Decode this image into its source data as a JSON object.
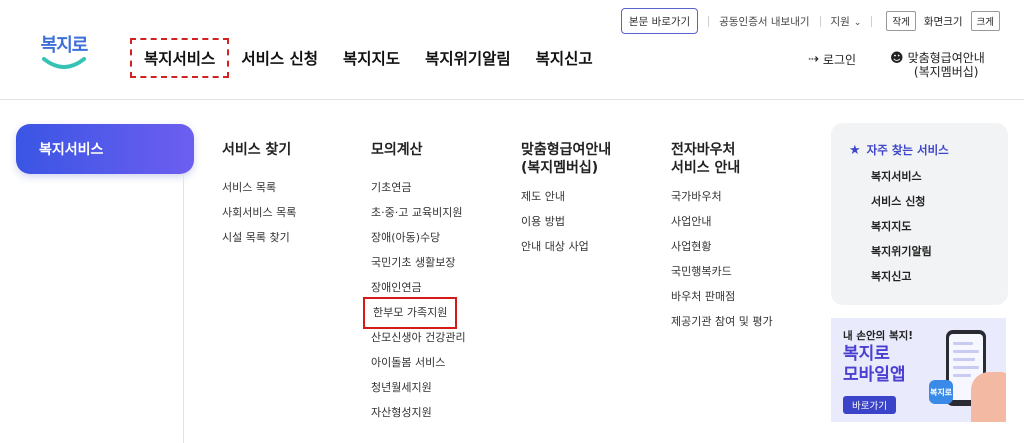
{
  "util": {
    "skip_label": "본문 바로가기",
    "cert_label": "공동인증서 내보내기",
    "support_label": "지원",
    "small_label": "작게",
    "zoom_label": "화면크기",
    "large_label": "크게"
  },
  "logo": {
    "text": "복지로"
  },
  "gnb": {
    "items": [
      {
        "label": "복지서비스"
      },
      {
        "label": "서비스 신청"
      },
      {
        "label": "복지지도"
      },
      {
        "label": "복지위기알림"
      },
      {
        "label": "복지신고"
      }
    ]
  },
  "user": {
    "login_label": "로그인",
    "custom_line1": "맞춤형급여안내",
    "custom_line2": "(복지멤버십)"
  },
  "mega": {
    "side_title": "복지서비스",
    "columns": [
      {
        "title": "서비스 찾기",
        "items": [
          "서비스 목록",
          "사회서비스 목록",
          "시설 목록 찾기"
        ]
      },
      {
        "title": "모의계산",
        "items": [
          "기초연금",
          "초·중·고 교육비지원",
          "장애(아동)수당",
          "국민기초 생활보장",
          "장애인연금",
          "한부모 가족지원",
          "산모신생아 건강관리",
          "아이돌봄 서비스",
          "청년월세지원",
          "자산형성지원"
        ]
      },
      {
        "title_line1": "맞춤형급여안내",
        "title_line2": "(복지멤버십)",
        "items": [
          "제도 안내",
          "이용 방법",
          "안내 대상 사업"
        ]
      },
      {
        "title_line1": "전자바우처",
        "title_line2": "서비스 안내",
        "items": [
          "국가바우처",
          "사업안내",
          "사업현황",
          "국민행복카드",
          "바우처 판매점",
          "제공기관 참여 및 평가"
        ]
      }
    ]
  },
  "favorites": {
    "title": "자주 찾는 서비스",
    "items": [
      "복지서비스",
      "서비스 신청",
      "복지지도",
      "복지위기알림",
      "복지신고"
    ]
  },
  "banner": {
    "subtitle": "내 손안의 복지!",
    "title_line1": "복지로",
    "title_line2": "모바일앱",
    "button_label": "바로가기",
    "app_icon_text": "복지로"
  },
  "colors": {
    "accent": "#3e45c8",
    "highlight_red": "#d61a1a",
    "pill_start": "#3a55e4",
    "pill_end": "#6d5ef0"
  },
  "icons": [
    "star-icon",
    "login-icon",
    "user-plus-icon",
    "chevron-down-icon"
  ]
}
